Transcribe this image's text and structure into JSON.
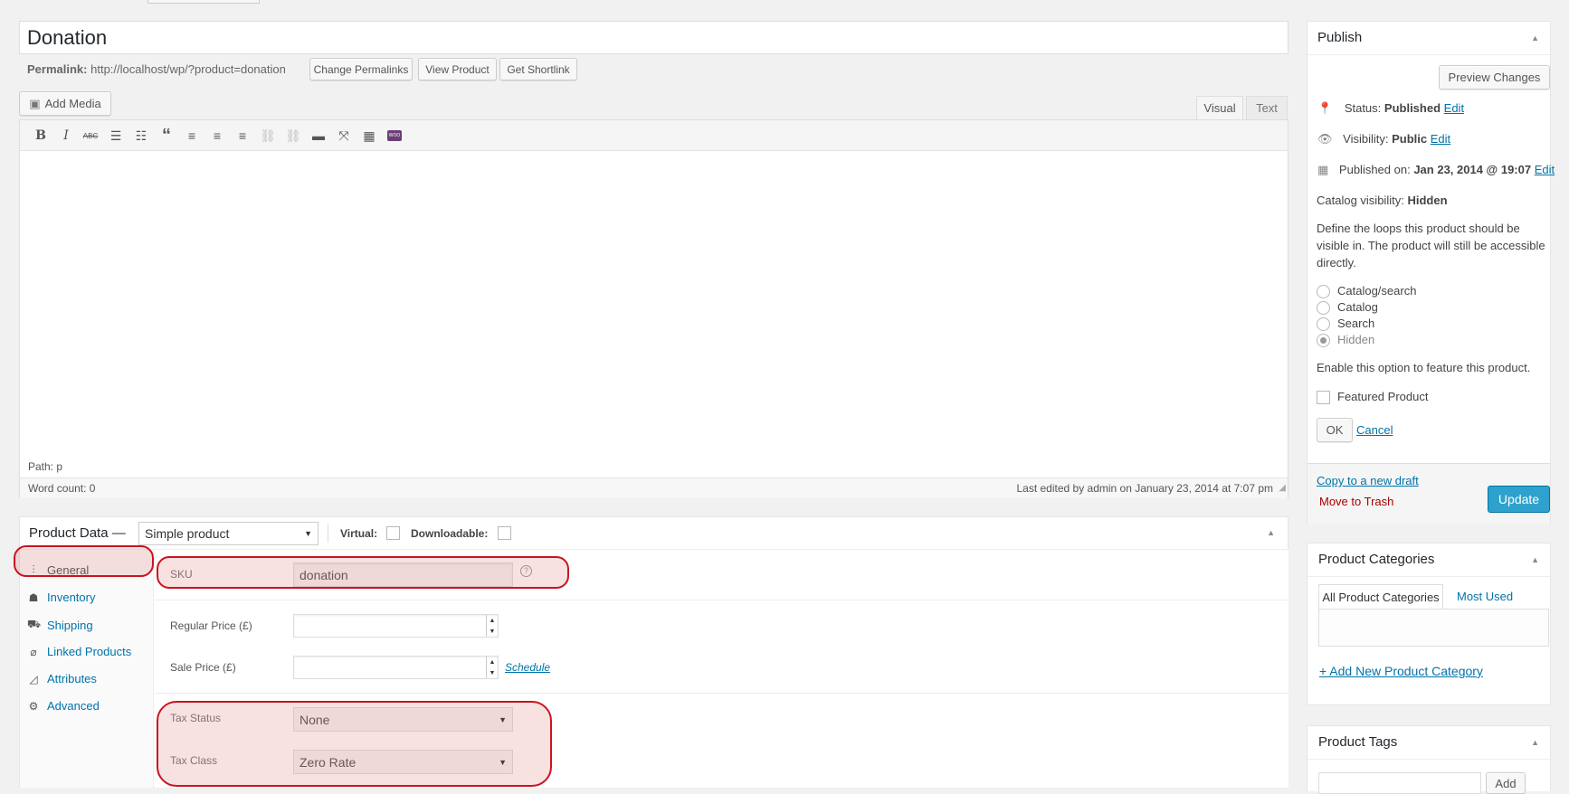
{
  "title_value": "Donation",
  "permalink": {
    "label": "Permalink:",
    "url": "http://localhost/wp/?product=donation",
    "change_button": "Change Permalinks",
    "view_button": "View Product",
    "shortlink_button": "Get Shortlink"
  },
  "editor": {
    "add_media": "Add Media",
    "tab_visual": "Visual",
    "tab_text": "Text",
    "path": "Path: p",
    "word_count": "Word count: 0",
    "last_edited": "Last edited by admin on January 23, 2014 at 7:07 pm",
    "toolbar": [
      "bold-icon",
      "italic-icon",
      "strikethrough-icon",
      "bullet-list-icon",
      "numbered-list-icon",
      "blockquote-icon",
      "align-left-icon",
      "align-center-icon",
      "align-right-icon",
      "link-icon",
      "unlink-icon",
      "read-more-icon",
      "fullscreen-icon",
      "kitchen-sink-icon",
      "woo-shortcode-icon"
    ]
  },
  "product_data": {
    "title": "Product Data —",
    "type_selected": "Simple product",
    "virtual_label": "Virtual:",
    "downloadable_label": "Downloadable:",
    "tabs": [
      {
        "label": "General",
        "icon": "sliders-icon"
      },
      {
        "label": "Inventory",
        "icon": "inventory-icon"
      },
      {
        "label": "Shipping",
        "icon": "truck-icon"
      },
      {
        "label": "Linked Products",
        "icon": "link-icon"
      },
      {
        "label": "Attributes",
        "icon": "attributes-icon"
      },
      {
        "label": "Advanced",
        "icon": "gear-icon"
      }
    ],
    "sku_label": "SKU",
    "sku_value": "donation",
    "regular_price_label": "Regular Price (£)",
    "sale_price_label": "Sale Price (£)",
    "schedule_link": "Schedule",
    "tax_status_label": "Tax Status",
    "tax_status_value": "None",
    "tax_class_label": "Tax Class",
    "tax_class_value": "Zero Rate"
  },
  "publish": {
    "title": "Publish",
    "preview_button": "Preview Changes",
    "status_label": "Status:",
    "status_value": "Published",
    "visibility_label": "Visibility:",
    "visibility_value": "Public",
    "published_label": "Published on:",
    "published_value": "Jan 23, 2014 @ 19:07",
    "edit_link": "Edit",
    "catalog_visibility_label": "Catalog visibility:",
    "catalog_visibility_value": "Hidden",
    "description": "Define the loops this product should be visible in. The product will still be accessible directly.",
    "options": [
      "Catalog/search",
      "Catalog",
      "Search",
      "Hidden"
    ],
    "feature_note": "Enable this option to feature this product.",
    "featured_label": "Featured Product",
    "ok_button": "OK",
    "cancel_link": "Cancel",
    "copy_draft": "Copy to a new draft",
    "trash": "Move to Trash",
    "update_button": "Update"
  },
  "categories": {
    "title": "Product Categories",
    "tab_all": "All Product Categories",
    "tab_most_used": "Most Used",
    "add_new": "+ Add New Product Category"
  },
  "tags": {
    "title": "Product Tags",
    "add_button": "Add"
  },
  "colors": {
    "accent": "#0073aa",
    "update_button": "#2ea2cc",
    "highlight": "#c9151e",
    "trash": "#a00"
  }
}
